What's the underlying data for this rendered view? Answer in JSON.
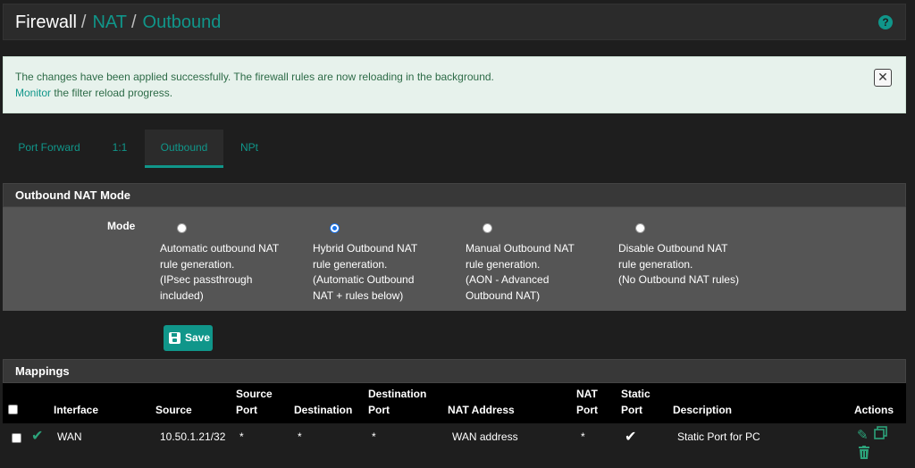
{
  "header": {
    "breadcrumb": [
      "Firewall",
      "NAT",
      "Outbound"
    ],
    "separator": "/",
    "help_icon": "question-circle-icon"
  },
  "alert": {
    "line1": "The changes have been applied successfully. The firewall rules are now reloading in the background.",
    "link": "Monitor",
    "line2_rest": " the filter reload progress.",
    "close_icon": "close-icon"
  },
  "tabs": [
    {
      "label": "Port Forward",
      "active": false
    },
    {
      "label": "1:1",
      "active": false
    },
    {
      "label": "Outbound",
      "active": true
    },
    {
      "label": "NPt",
      "active": false
    }
  ],
  "mode_panel": {
    "title": "Outbound NAT Mode",
    "mode_label": "Mode",
    "options": [
      {
        "text": "Automatic outbound NAT\nrule generation.\n(IPsec passthrough\nincluded)",
        "checked": false
      },
      {
        "text": "Hybrid Outbound NAT\nrule generation.\n(Automatic Outbound\nNAT + rules below)",
        "checked": true
      },
      {
        "text": "Manual Outbound NAT\nrule generation.\n(AON - Advanced\nOutbound NAT)",
        "checked": false
      },
      {
        "text": "Disable Outbound NAT\nrule generation.\n(No Outbound NAT rules)",
        "checked": false
      }
    ]
  },
  "save_button": {
    "label": "Save",
    "icon": "save-icon"
  },
  "mappings": {
    "title": "Mappings",
    "columns": [
      "Interface",
      "Source",
      "Source\nPort",
      "Destination",
      "Destination\nPort",
      "NAT Address",
      "NAT\nPort",
      "Static\nPort",
      "Description",
      "Actions"
    ],
    "rows": [
      {
        "enabled_icon": "check-icon",
        "interface": "WAN",
        "source": "10.50.1.21/32",
        "source_port": "*",
        "destination": "*",
        "destination_port": "*",
        "nat_address": "WAN address",
        "nat_port": "*",
        "static_port_icon": "check-icon",
        "description": "Static Port for PC",
        "actions": [
          "edit-icon",
          "copy-icon",
          "delete-icon"
        ]
      }
    ]
  },
  "colors": {
    "accent": "#10968a",
    "alert_bg": "#e7f2ec",
    "panel_body": "#555555",
    "table_head": "#000000"
  }
}
